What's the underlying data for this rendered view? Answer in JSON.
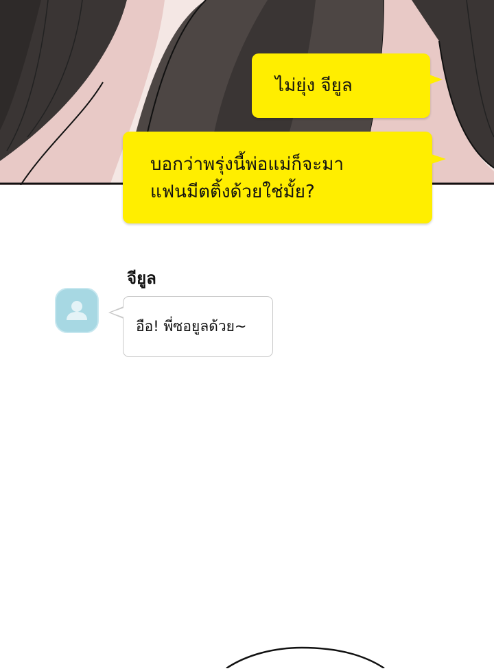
{
  "panel": {
    "colors": {
      "dark_hair": "#3a3534",
      "mid_hair": "#4d4644",
      "skin": "#e8c9c6",
      "skin_light": "#f4e7e4",
      "outline": "#111111"
    }
  },
  "messages": [
    {
      "side": "right",
      "style": "yellow",
      "text": "ไม่ยุ่ง จียูล"
    },
    {
      "side": "right",
      "style": "yellow",
      "text": "บอกว่าพรุ่งนี้พ่อแม่ก็จะมา\nแฟนมีตติ้งด้วยใช่มั้ย?"
    },
    {
      "side": "left",
      "style": "white",
      "sender": "จียูล",
      "avatar_icon": "default-user-icon",
      "text": "อือ! พี่ซอยูลด้วย~"
    }
  ],
  "colors": {
    "bubble_yellow": "#ffee00",
    "avatar_bg": "#a7d8e3",
    "bubble_border": "#c8c8c8"
  }
}
